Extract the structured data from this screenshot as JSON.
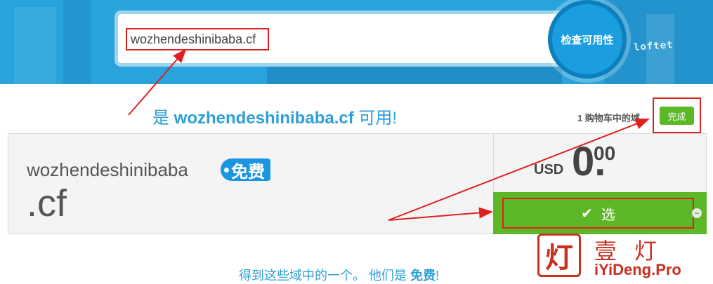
{
  "search": {
    "value": "wozhendeshinibaba.cf",
    "check_button": "检查可用性",
    "background_sign": "loftet"
  },
  "availability": {
    "prefix": "是 ",
    "domain": "wozhendeshinibaba.cf",
    "suffix": " 可用!"
  },
  "cart": {
    "count_text": "1 购物车中的域",
    "done_label": "完成"
  },
  "result": {
    "name": "wozhendeshinibaba",
    "tld": ".cf",
    "badge": "免费",
    "currency": "USD",
    "price_int": "0.",
    "price_dec": "00",
    "select_label": "选",
    "select_icon": "check-icon",
    "remove_icon": "minus-icon"
  },
  "bottom_note": {
    "text": "得到这些域中的一个。 他们是 ",
    "emph": "免费",
    "end": "!"
  },
  "watermark": {
    "glyph": "灯",
    "chinese": "壹 灯",
    "english": "iYiDeng.Pro"
  },
  "colors": {
    "accent_blue": "#2c9fd8",
    "hero_blue": "#29a3dc",
    "green": "#5cb827",
    "annotation_red": "#e02020",
    "watermark_red": "#c8301f"
  }
}
